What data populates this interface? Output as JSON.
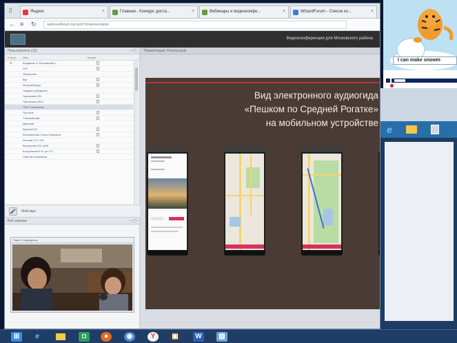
{
  "browser": {
    "tabs": [
      {
        "label": "Яндекс",
        "fav_color": "#e53935"
      },
      {
        "label": "Главная - Конкурс диста...",
        "fav_color": "#6a9a3a"
      },
      {
        "label": "Вебинары и видеоконфе...",
        "fav_color": "#6a9a3a"
      },
      {
        "label": "WizardForum - Список ко...",
        "fav_color": "#3f7fd0"
      }
    ],
    "url": "webinar4forum.ru/room/?id=presentation"
  },
  "app": {
    "header_title": "Видеоконференция для Московского района"
  },
  "participants": {
    "title": "Пользователи (32)",
    "columns": [
      "Статус",
      "Имя",
      "Медиа"
    ],
    "rows": [
      "Кондаков Л. Московский с.",
      "222",
      "Оборотень",
      "Вф",
      "МосковФорум",
      "Ландыш (обидный)",
      "Гарнанова 204",
      "Гарнанова 200-1",
      "7507 Спасимова",
      "Пустынь",
      "Т.Михайлова",
      "Дмитрий",
      "Бузина В.В.",
      "Бессмертная Ольга Юрьевна",
      "Мосова Л.Л. 204",
      "Витальева 319 ЦОК",
      "Кострюкова Е.В. ул.174",
      "Светлана Кармина"
    ],
    "selected_index": 8,
    "footer_label": "Мой звук"
  },
  "webcams": {
    "title": "Веб-камеры",
    "camera_title": "Павел Спиридонов"
  },
  "presentation": {
    "title": "Презентация: Рогатка.pptx",
    "slide_lines": [
      "Вид электронного аудиогида",
      "«Пешком по Средней Рогатке»",
      "на мобильном устройстве"
    ]
  },
  "cartoon": {
    "caption": "I can make snowm"
  }
}
